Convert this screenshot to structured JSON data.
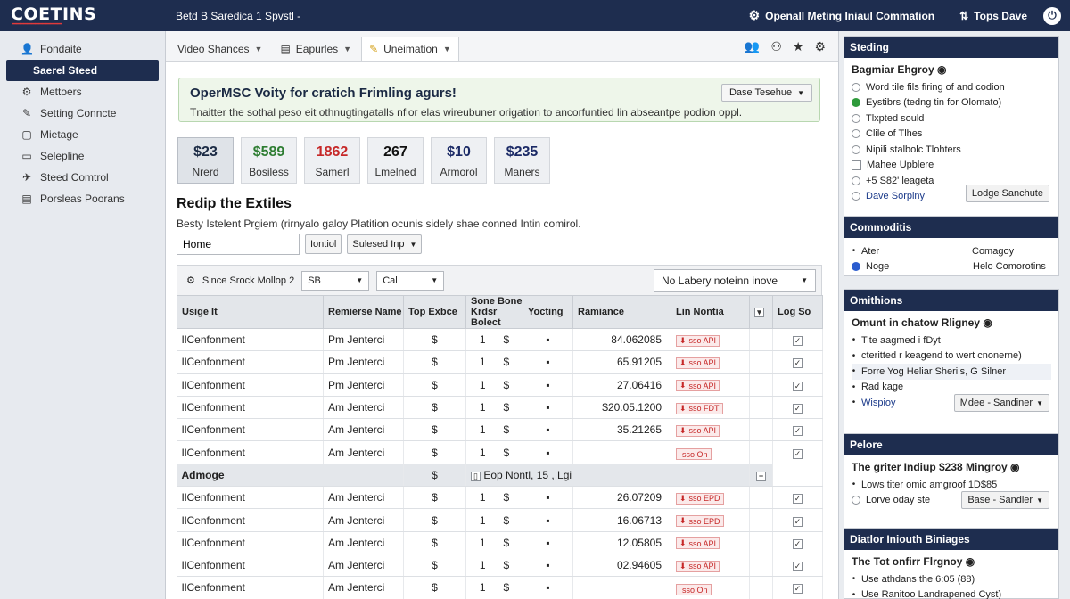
{
  "topbar": {
    "logo": "COETINS",
    "breadcrumb": "Betd B Saredica 1 Spvstl -",
    "action1": "Openall Meting Iniaul Commation",
    "action2": "Tops Dave"
  },
  "sidebar": {
    "items": [
      {
        "icon": "👤",
        "label": "Fondaite"
      },
      {
        "icon": "",
        "label": "Saerel Steed"
      },
      {
        "icon": "⚙",
        "label": "Mettoers"
      },
      {
        "icon": "✎",
        "label": "Setting Conncte"
      },
      {
        "icon": "▢",
        "label": "Mietage"
      },
      {
        "icon": "▭",
        "label": "Selepline"
      },
      {
        "icon": "✈",
        "label": "Steed Comtrol"
      },
      {
        "icon": "▤",
        "label": "Porsleas Poorans"
      }
    ]
  },
  "tabs": [
    {
      "label": "Video Shances"
    },
    {
      "label": "Eapurles"
    },
    {
      "label": "Uneimation"
    }
  ],
  "banner": {
    "title": "OperMSC Voity for cratich Frimling agurs!",
    "text": "Tnaitter the sothal peso eit othnugtingatalls nfior elas wireubuner origation to ancorfuntied lin abseantpe podion oppl.",
    "button": "Dase Tesehue"
  },
  "stats": [
    {
      "value": "$23",
      "label": "Nrerd",
      "color": "#1b2a44"
    },
    {
      "value": "$589",
      "label": "Bosiless",
      "color": "#2e7d32"
    },
    {
      "value": "1862",
      "label": "Samerl",
      "color": "#c62828"
    },
    {
      "value": "267",
      "label": "Lmelned",
      "color": "#111111"
    },
    {
      "value": "$10",
      "label": "Armorol",
      "color": "#1b2a66"
    },
    {
      "value": "$235",
      "label": "Maners",
      "color": "#1b2a66"
    }
  ],
  "section": {
    "title": "Redip the Extiles",
    "desc": "Besty Istelent Prgiem (rirnyalo galoy Platition ocunis sidely shae conned Intin comirol.",
    "input": "Home",
    "btn1": "Iontiol",
    "btn2": "Sulesed Inp"
  },
  "grid": {
    "toolbar_label": "Since Srock Mollop 2",
    "select1": "SB",
    "select2": "Cal",
    "search": "No Labery noteinn inove",
    "columns": [
      "Usige It",
      "Remierse Name",
      "Top Exbce",
      "Sone Bone Krdsr Bolect",
      "Yocting",
      "Ramiance",
      "Lin Nontia",
      "",
      "Log So"
    ],
    "rows": [
      {
        "name": "IlCenfonment",
        "ref": "Pm Jenterci",
        "amount": "84.062085",
        "pill": "sso API"
      },
      {
        "name": "IlCenfonment",
        "ref": "Pm Jenterci",
        "amount": "65.91205",
        "pill": "sso API"
      },
      {
        "name": "IlCenfonment",
        "ref": "Pm Jenterci",
        "amount": "27.06416",
        "pill": "sso API"
      },
      {
        "name": "IlCenfonment",
        "ref": "Am Jenterci",
        "amount": "$20.05.1200",
        "pill": "sso FDT"
      },
      {
        "name": "IlCenfonment",
        "ref": "Am Jenterci",
        "amount": "35.21265",
        "pill": "sso API"
      },
      {
        "name": "IlCenfonment",
        "ref": "Am Jenterci",
        "amount": "",
        "pill": "sso On"
      }
    ],
    "group": {
      "label": "Admoge",
      "note": "Eop Nontl,  15 , Lgi"
    },
    "rows2": [
      {
        "name": "IlCenfonment",
        "ref": "Am Jenterci",
        "amount": "26.07209",
        "pill": "sso EPD"
      },
      {
        "name": "IlCenfonment",
        "ref": "Am Jenterci",
        "amount": "16.06713",
        "pill": "sso EPD"
      },
      {
        "name": "IlCenfonment",
        "ref": "Am Jenterci",
        "amount": "12.05805",
        "pill": "sso API"
      },
      {
        "name": "IlCenfonment",
        "ref": "Am Jenterci",
        "amount": "02.94605",
        "pill": "sso API"
      },
      {
        "name": "IlCenfonment",
        "ref": "Am Jenterci",
        "amount": "",
        "pill": "sso On"
      }
    ]
  },
  "panels": {
    "p1": {
      "head": "Steding",
      "title": "Bagmiar Ehgroy",
      "rows": [
        "Word tile fils firing of and codion",
        "Eystibrs (tedng tin for Olomato)",
        "Tlxpted sould",
        "Clile of Tlhes",
        "Nipili stalbolc Tlohters",
        "Mahee Upblere",
        "+5 S82' leageta",
        "Dave Sorpiny"
      ],
      "button": "Lodge Sanchute"
    },
    "p2": {
      "head": "Commoditis",
      "items": [
        [
          "Ater",
          "Comagoy"
        ],
        [
          "Noge",
          "Helo Comorotins"
        ]
      ]
    },
    "p3": {
      "head": "Omithions",
      "title": "Omunt in chatow Rligney",
      "rows": [
        "Tite aagmed i fDyt",
        "cteritted r keagend to wert cnonerne)",
        "Forre Yog Heliar Sherils, G Silner",
        "Rad kage",
        "Wispioy"
      ],
      "button": "Mdee - Sandiner"
    },
    "p4": {
      "head": "Pelore",
      "title": "The griter Indiup $238 Mingroy",
      "rows": [
        "Lows titer omic amgroof 1D$85",
        "Lorve oday ste"
      ],
      "button": "Base - Sandler"
    },
    "p5": {
      "head": "Diatlor Iniouth Biniages",
      "title": "The Tot onfirr Flrgnoy",
      "rows": [
        "Use athdans the 6:05 (88)",
        "Use Ranitoo Landrapened Cyst)"
      ]
    }
  }
}
